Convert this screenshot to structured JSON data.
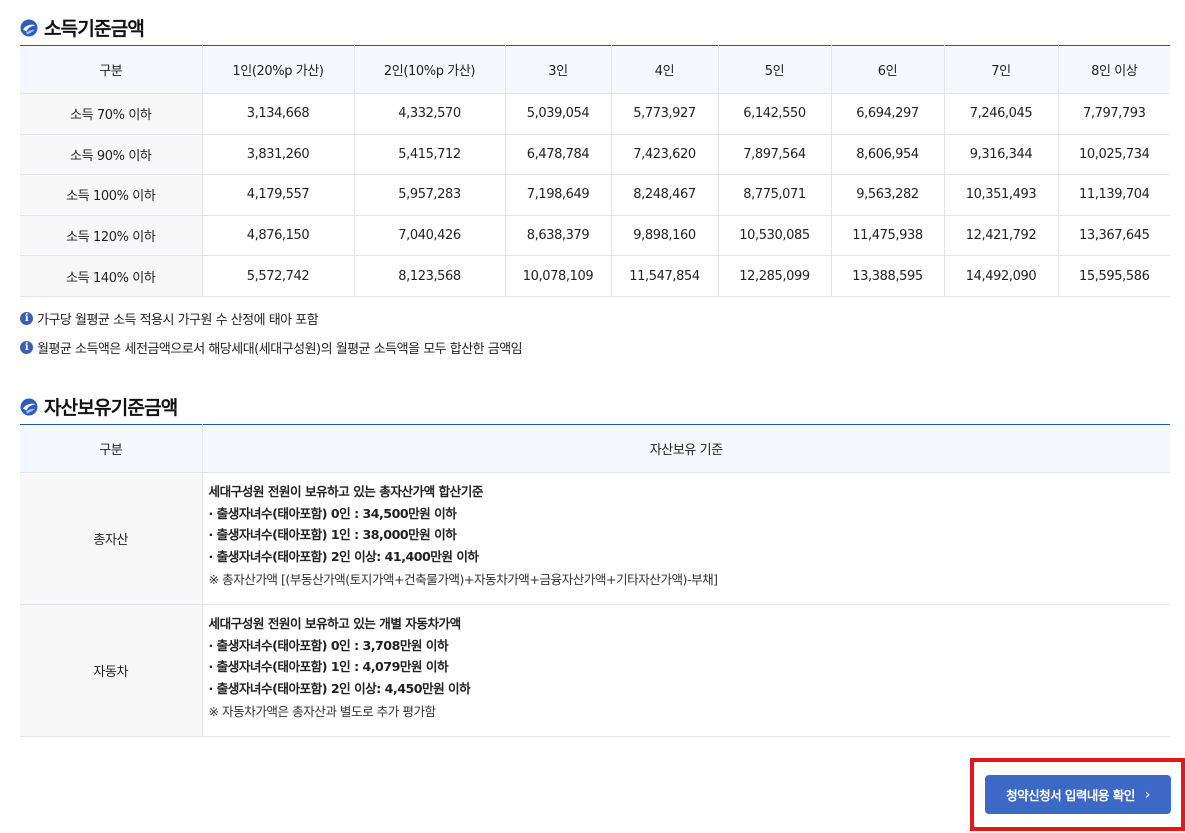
{
  "income_section": {
    "title": "소득기준금액",
    "headers": [
      "구분",
      "1인(20%p 가산)",
      "2인(10%p 가산)",
      "3인",
      "4인",
      "5인",
      "6인",
      "7인",
      "8인 이상"
    ],
    "rows": [
      {
        "label": "소득 70% 이하",
        "values": [
          "3,134,668",
          "4,332,570",
          "5,039,054",
          "5,773,927",
          "6,142,550",
          "6,694,297",
          "7,246,045",
          "7,797,793"
        ]
      },
      {
        "label": "소득 90% 이하",
        "values": [
          "3,831,260",
          "5,415,712",
          "6,478,784",
          "7,423,620",
          "7,897,564",
          "8,606,954",
          "9,316,344",
          "10,025,734"
        ]
      },
      {
        "label": "소득 100% 이하",
        "values": [
          "4,179,557",
          "5,957,283",
          "7,198,649",
          "8,248,467",
          "8,775,071",
          "9,563,282",
          "10,351,493",
          "11,139,704"
        ]
      },
      {
        "label": "소득 120% 이하",
        "values": [
          "4,876,150",
          "7,040,426",
          "8,638,379",
          "9,898,160",
          "10,530,085",
          "11,475,938",
          "12,421,792",
          "13,367,645"
        ]
      },
      {
        "label": "소득 140% 이하",
        "values": [
          "5,572,742",
          "8,123,568",
          "10,078,109",
          "11,547,854",
          "12,285,099",
          "13,388,595",
          "14,492,090",
          "15,595,586"
        ]
      }
    ],
    "notes": [
      "가구당 월평균 소득 적용시 가구원 수 산정에 태아 포함",
      "월평균 소득액은 세전금액으로서 해당세대(세대구성원)의 월평균 소득액을 모두 합산한 금액임"
    ]
  },
  "asset_section": {
    "title": "자산보유기준금액",
    "headers": [
      "구분",
      "자산보유 기준"
    ],
    "rows": [
      {
        "label": "총자산",
        "lines": [
          "세대구성원 전원이 보유하고 있는 총자산가액 합산기준",
          "· 출생자녀수(태아포함) 0인 : 34,500만원 이하",
          "· 출생자녀수(태아포함) 1인 : 38,000만원 이하",
          "· 출생자녀수(태아포함) 2인 이상: 41,400만원 이하"
        ],
        "remark": "※  총자산가액 [(부동산가액(토지가액+건축물가액)+자동차가액+금융자산가액+기타자산가액)-부채]"
      },
      {
        "label": "자동차",
        "lines": [
          "세대구성원 전원이 보유하고 있는 개별 자동차가액",
          "· 출생자녀수(태아포함) 0인 : 3,708만원 이하",
          "· 출생자녀수(태아포함) 1인 : 4,079만원 이하",
          "· 출생자녀수(태아포함) 2인 이상: 4,450만원 이하"
        ],
        "remark": "※  자동차가액은 총자산과 별도로 추가 평가함"
      }
    ]
  },
  "confirm_button": {
    "label": "청약신청서 입력내용 확인",
    "chevron": "›"
  },
  "icons": {
    "section_icon": "swirl-icon",
    "note_icon": "info-icon",
    "info_glyph": "i"
  },
  "colors": {
    "accent": "#1f5aa6",
    "button": "#3d68c6",
    "highlight_frame": "#e8141b",
    "header_bg": "#f4f8fc"
  }
}
